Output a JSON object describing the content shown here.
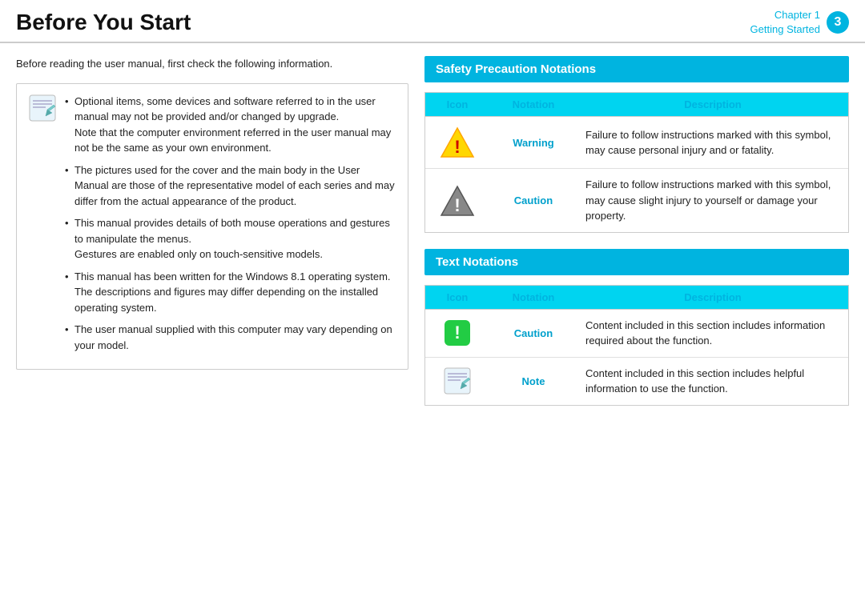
{
  "header": {
    "title": "Before You Start",
    "chapter_label": "Chapter 1",
    "section_label": "Getting Started",
    "page_number": "3"
  },
  "left": {
    "intro": "Before reading the user manual, first check the following information.",
    "bullets": [
      "Optional items, some devices and software referred to in the user manual may not be provided and/or changed by upgrade.\nNote that the computer environment referred in the user manual may not be the same as your own environment.",
      "The pictures used for the cover and the main body in the User Manual are those of the representative model of each series and may differ from the actual appearance of the product.",
      "This manual provides details of both mouse operations and gestures to manipulate the menus.\nGestures are enabled only on touch-sensitive models.",
      "This manual has been written for the Windows 8.1 operating system. The descriptions and figures may differ depending on the installed operating system.",
      "The user manual supplied with this computer may vary depending on your model."
    ]
  },
  "safety_section": {
    "title": "Safety Precaution Notations",
    "table_headers": {
      "icon": "Icon",
      "notation": "Notation",
      "description": "Description"
    },
    "rows": [
      {
        "notation": "Warning",
        "description": "Failure to follow instructions marked with this symbol, may cause personal injury and or fatality."
      },
      {
        "notation": "Caution",
        "description": "Failure to follow instructions marked with this symbol, may cause slight injury to yourself or damage your property."
      }
    ]
  },
  "text_section": {
    "title": "Text Notations",
    "table_headers": {
      "icon": "Icon",
      "notation": "Notation",
      "description": "Description"
    },
    "rows": [
      {
        "notation": "Caution",
        "description": "Content included in this section includes information required about the function."
      },
      {
        "notation": "Note",
        "description": "Content included in this section includes helpful information to use the function."
      }
    ]
  }
}
